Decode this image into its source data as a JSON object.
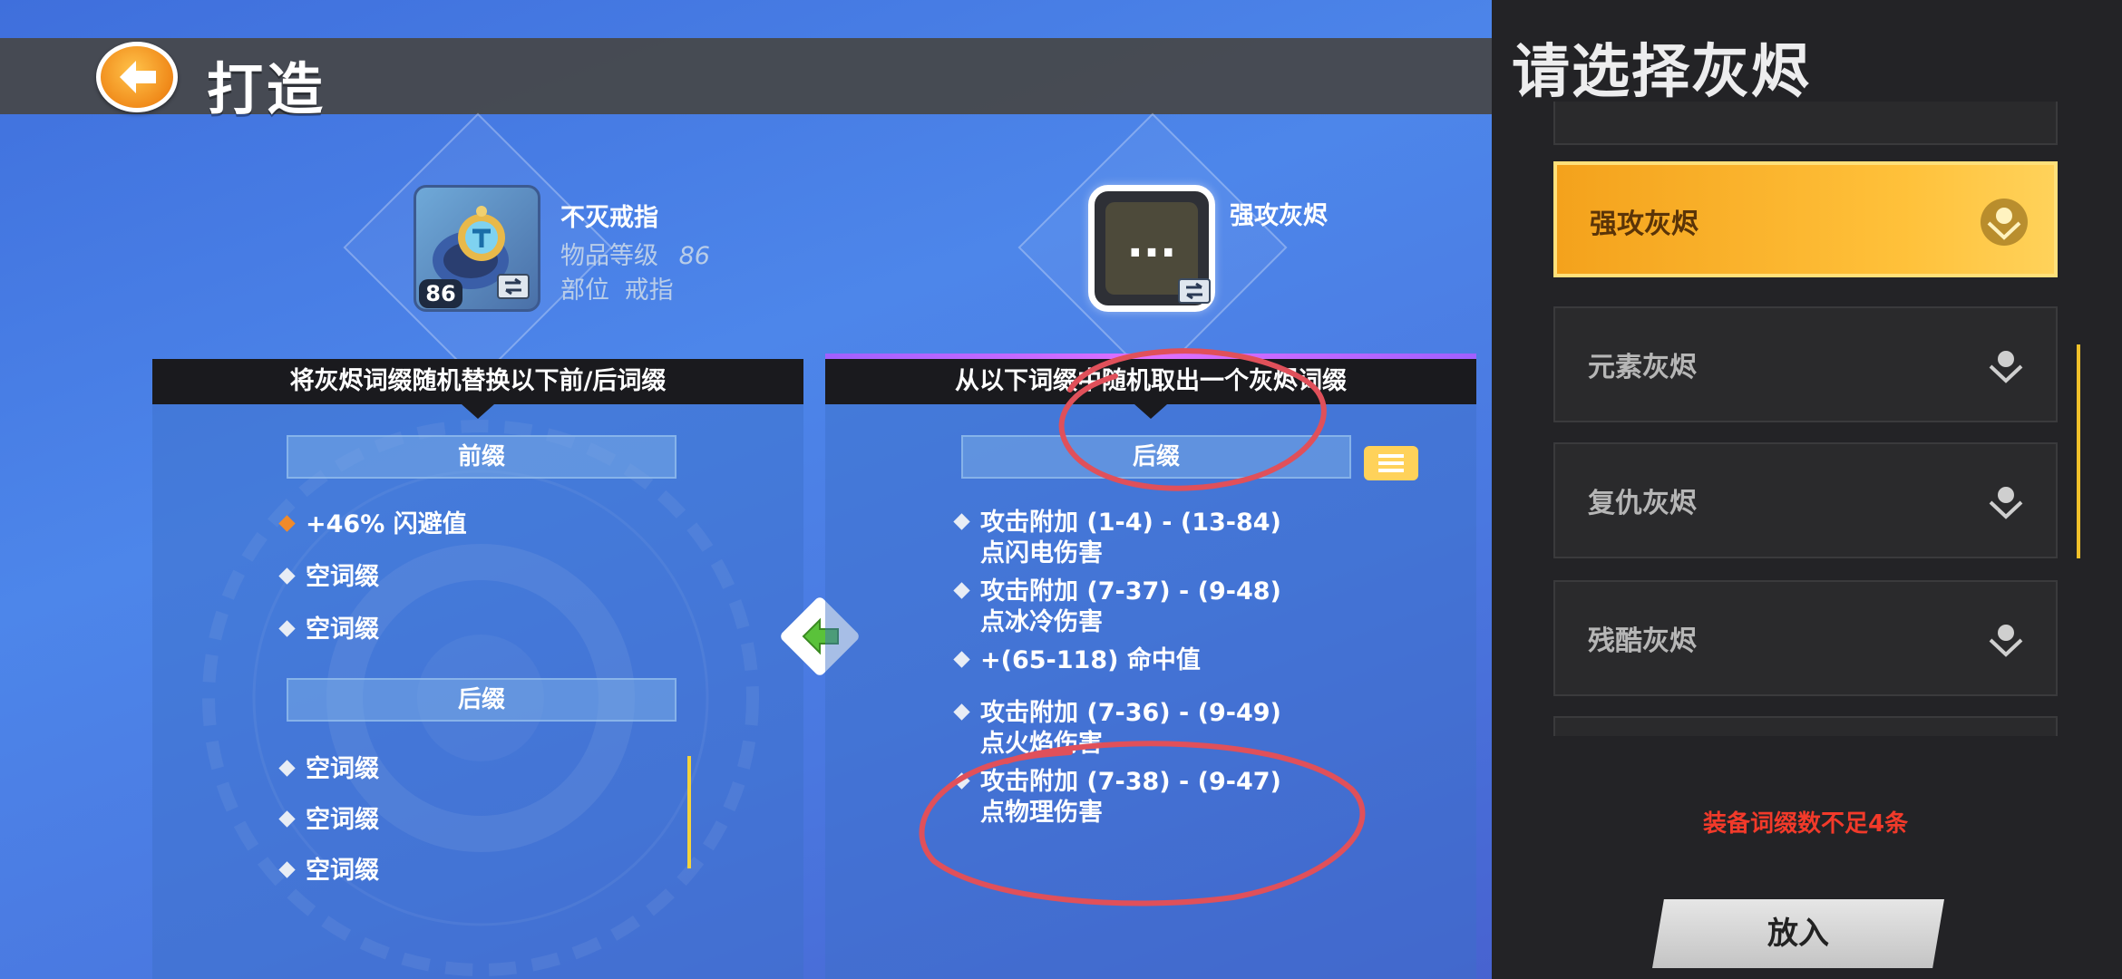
{
  "header": {
    "title": "打造"
  },
  "item": {
    "name": "不灭戒指",
    "level_label": "物品等级",
    "level": "86",
    "slot_label": "部位",
    "slot": "戒指",
    "badge_level": "86"
  },
  "ember": {
    "name": "强攻灰烬",
    "icon_text": "..."
  },
  "left_panel": {
    "header": "将灰烬词缀随机替换以下前/后词缀",
    "prefix_label": "前缀",
    "prefix_affixes": [
      {
        "text": "+46% 闪避值",
        "marker": "orange"
      },
      {
        "text": "空词缀",
        "marker": "white"
      },
      {
        "text": "空词缀",
        "marker": "white"
      }
    ],
    "suffix_label": "后缀",
    "suffix_affixes": [
      {
        "text": "空词缀"
      },
      {
        "text": "空词缀"
      },
      {
        "text": "空词缀"
      }
    ]
  },
  "right_panel": {
    "header": "从以下词缀中随机取出一个灰烬词缀",
    "suffix_label": "后缀",
    "affixes": [
      {
        "line1": "攻击附加 (1-4) - (13-84)",
        "line2": "点闪电伤害"
      },
      {
        "line1": "攻击附加 (7-37) - (9-48)",
        "line2": "点冰冷伤害"
      },
      {
        "line1": "+(65-118) 命中值",
        "line2": ""
      },
      {
        "line1": "攻击附加 (7-36) - (9-49)",
        "line2": "点火焰伤害"
      },
      {
        "line1": "攻击附加 (7-38) - (9-47)",
        "line2": "点物理伤害"
      }
    ]
  },
  "sidebar": {
    "title": "请选择灰烬",
    "items": [
      {
        "label": "强攻灰烬",
        "selected": true
      },
      {
        "label": "元素灰烬",
        "selected": false
      },
      {
        "label": "复仇灰烬",
        "selected": false
      },
      {
        "label": "残酷灰烬",
        "selected": false
      }
    ],
    "warning": "装备词缀数不足4条",
    "place_button": "放入"
  },
  "colors": {
    "accent": "#ffc13a",
    "warning": "#f23a2a",
    "annotation": "#e0505a"
  }
}
